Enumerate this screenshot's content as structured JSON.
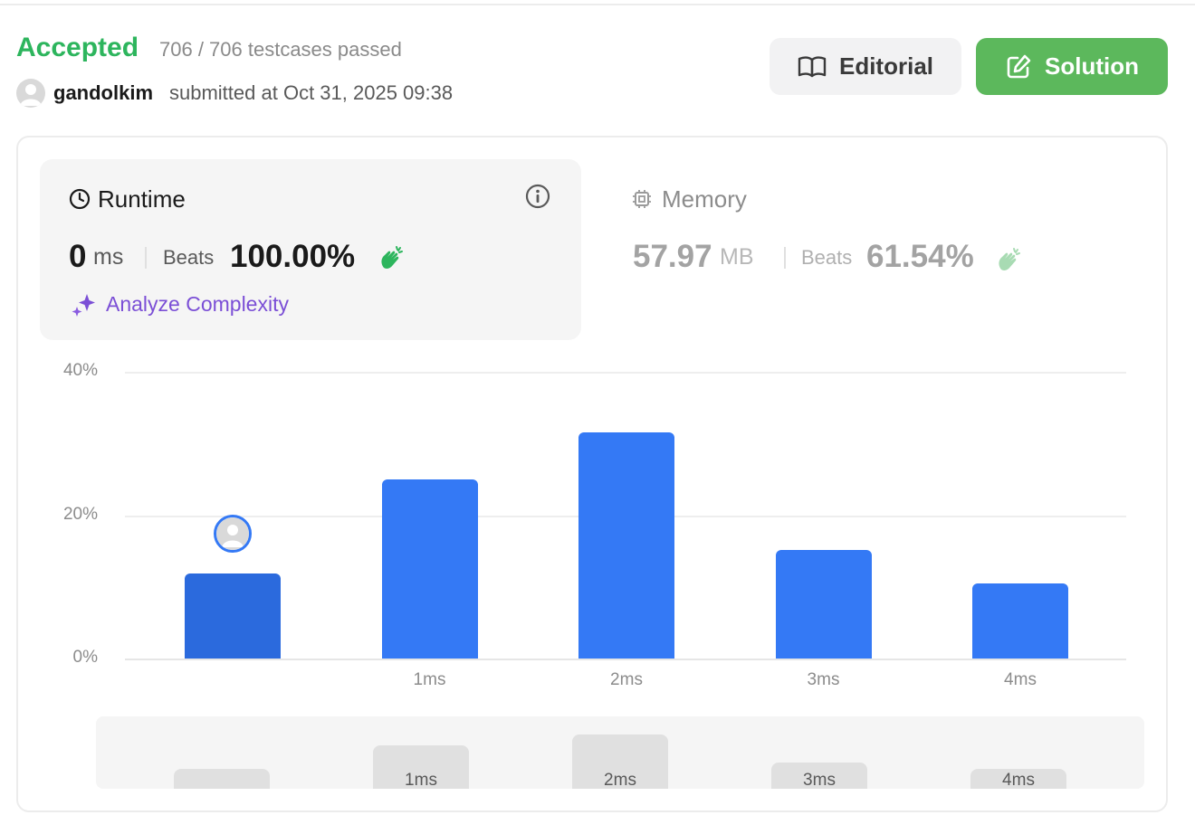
{
  "header": {
    "status": "Accepted",
    "testcases": "706 / 706 testcases passed",
    "username": "gandolkim",
    "submitted": "submitted at Oct 31, 2025 09:38",
    "editorial_label": "Editorial",
    "solution_label": "Solution"
  },
  "runtime": {
    "title": "Runtime",
    "value": "0",
    "unit": "ms",
    "beats_label": "Beats",
    "beats_pct": "100.00%",
    "analyze_label": "Analyze Complexity"
  },
  "memory": {
    "title": "Memory",
    "value": "57.97",
    "unit": "MB",
    "beats_label": "Beats",
    "beats_pct": "61.54%"
  },
  "colors": {
    "accepted": "#2db55d",
    "bar": "#3479f5",
    "bar_mine": "#2b6add",
    "solution_button": "#5cb85c"
  },
  "chart_data": {
    "type": "bar",
    "categories": [
      "",
      "1ms",
      "2ms",
      "3ms",
      "4ms"
    ],
    "values": [
      11.8,
      25.0,
      31.5,
      15.1,
      10.5
    ],
    "y_ticks": [
      "40%",
      "20%",
      "0%"
    ],
    "ylim": [
      0,
      40
    ],
    "user_bar_index": 0,
    "grid": true
  },
  "overview": {
    "labels": [
      "",
      "1ms",
      "2ms",
      "3ms",
      "4ms"
    ]
  }
}
